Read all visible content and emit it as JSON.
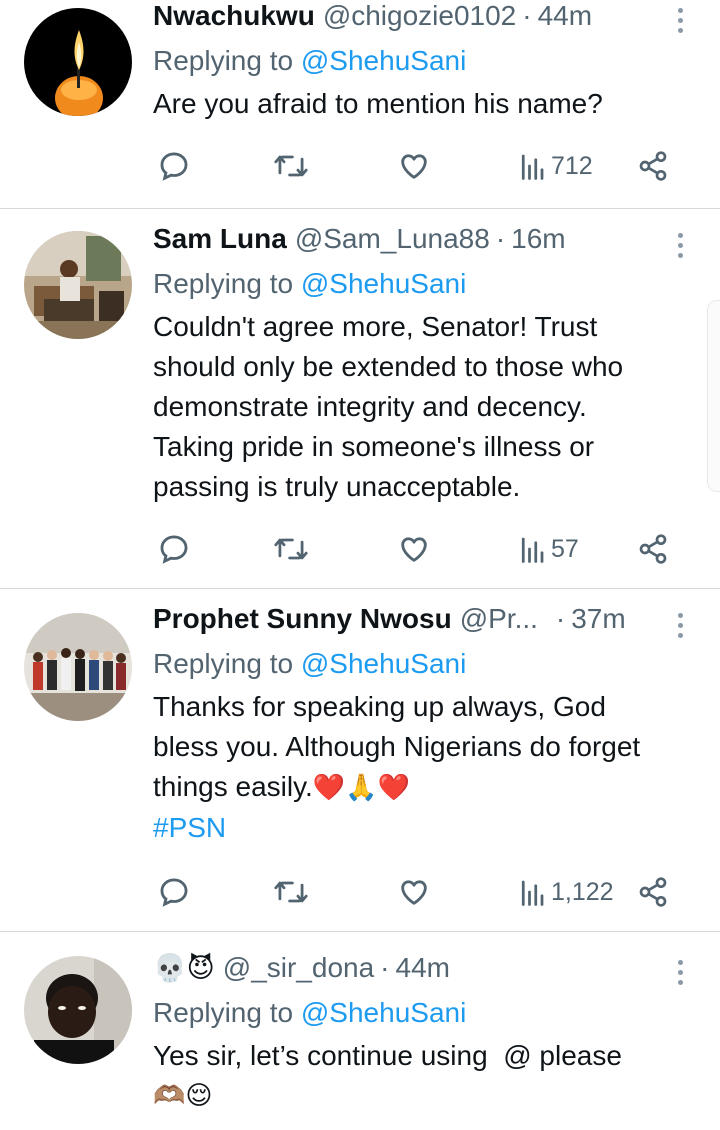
{
  "replies": [
    {
      "display_name": "Nwachukwu",
      "handle": "@chigozie0102",
      "time": "44m",
      "replying_prefix": "Replying to",
      "replying_to": "@ShehuSani",
      "text": "Are you afraid to mention his name?",
      "views": "712",
      "avatar_icon": "candle-avatar"
    },
    {
      "display_name": "Sam Luna",
      "handle": "@Sam_Luna88",
      "time": "16m",
      "replying_prefix": "Replying to",
      "replying_to": "@ShehuSani",
      "text_lines": [
        "Couldn't agree more, Senator! Trust",
        "should only be extended to those who",
        "demonstrate integrity and decency.",
        "Taking pride in someone's illness or",
        "passing is truly unacceptable."
      ],
      "views": "57",
      "avatar_icon": "room-photo-avatar"
    },
    {
      "display_name": "Prophet Sunny Nwosu",
      "handle": "@Pr...",
      "time": "37m",
      "replying_prefix": "Replying to",
      "replying_to": "@ShehuSani",
      "text_lines": [
        "Thanks for speaking up always, God",
        "bless you. Although Nigerians do forget",
        "things easily."
      ],
      "emoji_trail": "❤️🙏❤️",
      "hashtag": "#PSN",
      "views": "1,122",
      "avatar_icon": "group-photo-avatar"
    },
    {
      "display_name_emoji": "💀😈",
      "handle": "@_sir_dona",
      "time": "44m",
      "replying_prefix": "Replying to",
      "replying_to": "@ShehuSani",
      "text": "Yes sir, let’s continue using  @ please",
      "emoji_line": "🫶🏽😌",
      "avatar_icon": "person-photo-avatar"
    }
  ],
  "colors": {
    "accent": "#1d9bf0",
    "secondary_text": "#536471",
    "primary_text": "#0f1419",
    "divider": "#d4d8dc"
  },
  "icons": [
    "reply-icon",
    "retweet-icon",
    "like-icon",
    "views-icon",
    "share-icon",
    "more-icon"
  ]
}
